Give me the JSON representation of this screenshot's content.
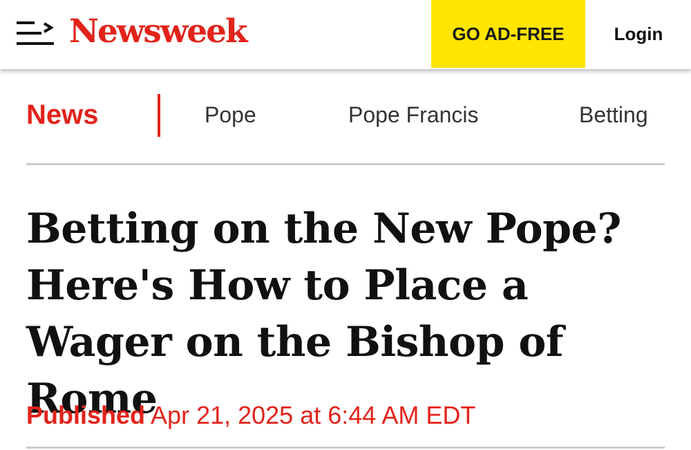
{
  "header": {
    "logo_text": "Newsweek",
    "ad_free_label": "GO AD-FREE",
    "login_label": "Login",
    "menu_icon": "menu-icon"
  },
  "nav": {
    "section_label": "News",
    "tags": [
      "Pope",
      "Pope Francis",
      "Betting"
    ]
  },
  "article": {
    "headline": "Betting on the New Pope? Here's How to Place a Wager on the Bishop of Rome",
    "published_label": "Published",
    "published_date": "Apr 21, 2025 at 6:44 AM EDT"
  },
  "colors": {
    "brand_red": "#e2231a",
    "ad_free_yellow": "#ffe500",
    "text_dark": "#111111",
    "nav_gray": "#333333",
    "rule_gray": "#cccccc"
  }
}
